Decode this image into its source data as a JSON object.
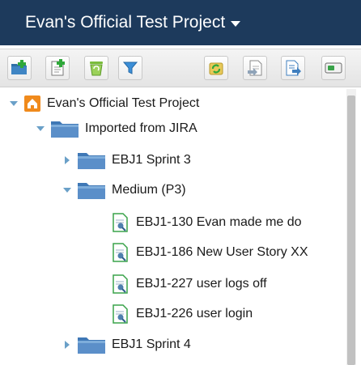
{
  "header": {
    "project_name": "Evan's Official Test Project"
  },
  "toolbar": {
    "buttons": [
      {
        "icon": "add-folder-icon"
      },
      {
        "icon": "add-requirement-icon"
      },
      {
        "icon": "recycle-icon"
      },
      {
        "icon": "filter-icon"
      },
      {
        "icon": "refresh-icon"
      },
      {
        "icon": "import-icon"
      },
      {
        "icon": "export-icon"
      },
      {
        "icon": "toggle-view-icon"
      }
    ]
  },
  "tree": {
    "root": {
      "label": "Evan's Official Test Project",
      "icon": "home-icon",
      "expanded": true
    },
    "folders": [
      {
        "label": "Imported from JIRA",
        "expanded": true
      },
      {
        "label": "EBJ1 Sprint 3",
        "expanded": false
      },
      {
        "label": "Medium (P3)",
        "expanded": true
      },
      {
        "label": "EBJ1 Sprint 4",
        "expanded": false
      }
    ],
    "items": [
      {
        "label": "EBJ1-130 Evan made me do"
      },
      {
        "label": "EBJ1-186 New User Story XX"
      },
      {
        "label": "EBJ1-227 user logs off"
      },
      {
        "label": "EBJ1-226 user login"
      }
    ]
  },
  "colors": {
    "header_bg": "#1d3a5c",
    "folder_blue": "#5b8fc9",
    "home_orange": "#f08a1c",
    "req_green": "#3aa34a"
  }
}
